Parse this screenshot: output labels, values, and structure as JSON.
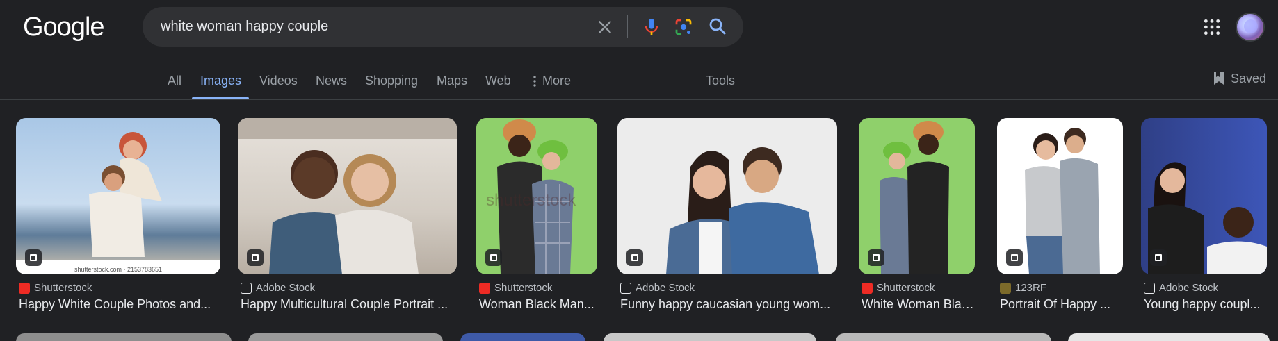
{
  "logo": "Google",
  "search": {
    "query": "white woman happy couple"
  },
  "icons": {
    "clear": "close-icon",
    "mic": "microphone-icon",
    "lens": "lens-icon",
    "search": "search-icon",
    "apps": "apps-grid-icon",
    "saved": "bookmark-icon",
    "more": "more-vert-icon"
  },
  "tabs": [
    {
      "label": "All"
    },
    {
      "label": "Images",
      "active": true
    },
    {
      "label": "Videos"
    },
    {
      "label": "News"
    },
    {
      "label": "Shopping"
    },
    {
      "label": "Maps"
    },
    {
      "label": "Web"
    },
    {
      "label": "More"
    }
  ],
  "tools": "Tools",
  "saved": "Saved",
  "results": [
    {
      "source": "Shutterstock",
      "title": "Happy White Couple Photos and...",
      "caption": "shutterstock.com · 2153783651"
    },
    {
      "source": "Adobe Stock",
      "title": "Happy Multicultural Couple Portrait ..."
    },
    {
      "source": "Shutterstock",
      "title": "Woman Black Man...",
      "watermark": "shutterstock"
    },
    {
      "source": "Adobe Stock",
      "title": "Funny happy caucasian young wom..."
    },
    {
      "source": "Shutterstock",
      "title": "White Woman Blac..."
    },
    {
      "source": "123RF",
      "title": "Portrait Of Happy ..."
    },
    {
      "source": "Adobe Stock",
      "title": "Young happy coupl..."
    }
  ],
  "colors": {
    "background": "#202124",
    "accent": "#8ab4f8",
    "text": "#e8eaed",
    "muted": "#9aa0a6"
  }
}
